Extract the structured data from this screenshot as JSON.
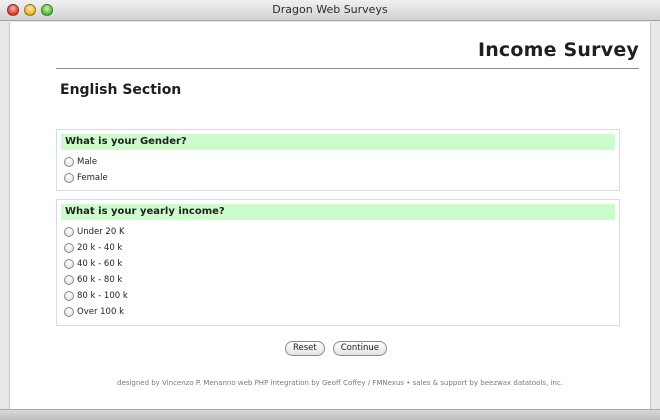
{
  "window": {
    "title": "Dragon Web Surveys"
  },
  "page": {
    "title": "Income Survey",
    "section_title": "English Section"
  },
  "questions": {
    "gender": {
      "prompt": "What is your Gender?",
      "options": [
        "Male",
        "Female"
      ]
    },
    "income": {
      "prompt": "What is your yearly income?",
      "options": [
        "Under 20 K",
        "20 k - 40 k",
        "40 k - 60 k",
        "60 k - 80 k",
        "80 k - 100 k",
        "Over 100 k"
      ]
    }
  },
  "buttons": {
    "reset": "Reset",
    "continue": "Continue"
  },
  "footer": "designed by Vincenzo P. Menanno web PHP integration by Geoff Coffey / FMNexus • sales & support by beezwax datatools, inc.",
  "colors": {
    "question_header_bg": "#ccfccb"
  }
}
